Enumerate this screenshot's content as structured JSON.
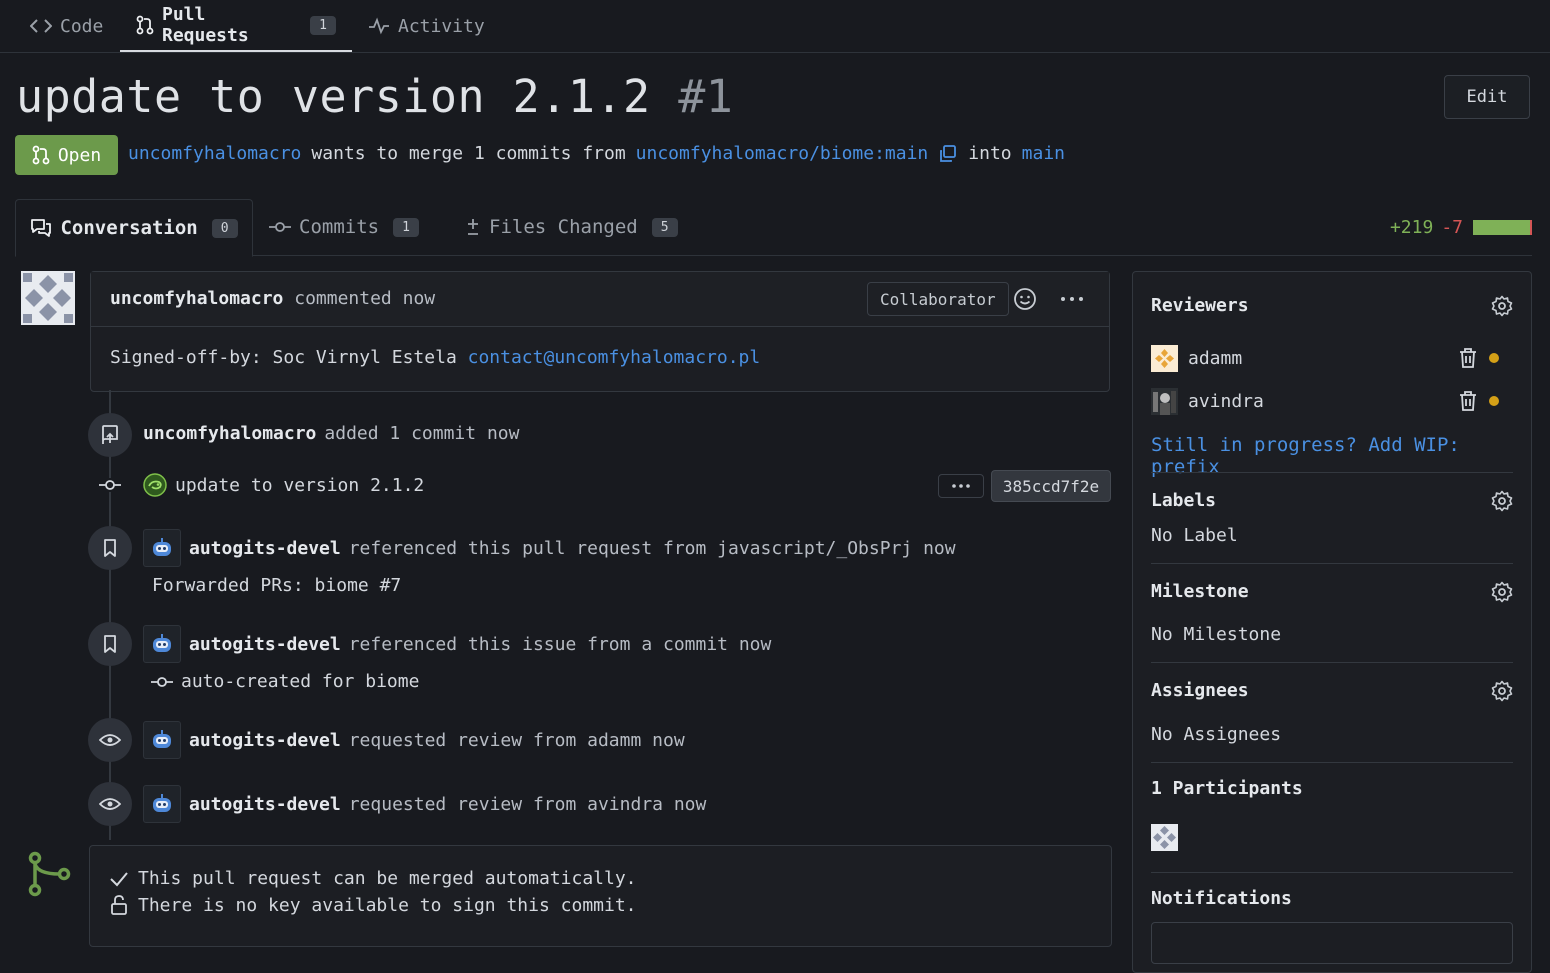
{
  "repo_tabs": [
    {
      "label": "Code"
    },
    {
      "label": "Pull Requests",
      "count": "1"
    },
    {
      "label": "Activity"
    }
  ],
  "pr": {
    "title": "update to version 2.1.2",
    "number": "#1",
    "edit_label": "Edit",
    "status": "Open",
    "author": "uncomfyhalomacro",
    "merge_text": "wants to merge 1 commits from",
    "source_branch": "uncomfyhalomacro/biome:main",
    "into_text": "into",
    "target_branch": "main"
  },
  "pr_tabs": [
    {
      "label": "Conversation",
      "count": "0"
    },
    {
      "label": "Commits",
      "count": "1"
    },
    {
      "label": "Files Changed",
      "count": "5"
    }
  ],
  "diffstat": {
    "additions": "+219",
    "deletions": "-7",
    "additions_ratio": 0.97
  },
  "comment": {
    "author": "uncomfyhalomacro",
    "action": "commented now",
    "role": "Collaborator",
    "body_text": "Signed-off-by: Soc Virnyl Estela",
    "body_link": "contact@uncomfyhalomacro.pl"
  },
  "timeline": {
    "push": {
      "actor": "uncomfyhalomacro",
      "text": "added 1 commit now"
    },
    "commit": {
      "message": "update to version 2.1.2",
      "sha": "385ccd7f2e"
    },
    "ref1": {
      "actor": "autogits-devel",
      "text": "referenced this pull request from javascript/_ObsPrj now",
      "detail": "Forwarded PRs: biome #7"
    },
    "ref2": {
      "actor": "autogits-devel",
      "text": "referenced this issue from a commit now",
      "detail": "auto-created for biome"
    },
    "review1": {
      "actor": "autogits-devel",
      "text": "requested review from adamm now"
    },
    "review2": {
      "actor": "autogits-devel",
      "text": "requested review from avindra now"
    }
  },
  "merge": {
    "line1": "This pull request can be merged automatically.",
    "line2": "There is no key available to sign this commit."
  },
  "sidebar": {
    "reviewers_title": "Reviewers",
    "reviewers": [
      {
        "name": "adamm"
      },
      {
        "name": "avindra"
      }
    ],
    "wip_hint": "Still in progress? Add WIP: prefix",
    "labels_title": "Labels",
    "labels_value": "No Label",
    "milestone_title": "Milestone",
    "milestone_value": "No Milestone",
    "assignees_title": "Assignees",
    "assignees_value": "No Assignees",
    "participants_title": "1 Participants",
    "notifications_title": "Notifications"
  },
  "colors": {
    "accent": "#4a90e2",
    "open_badge": "#6c9a4b",
    "additions": "#7fb157",
    "deletions": "#d45555",
    "pending_dot": "#d4a017"
  }
}
